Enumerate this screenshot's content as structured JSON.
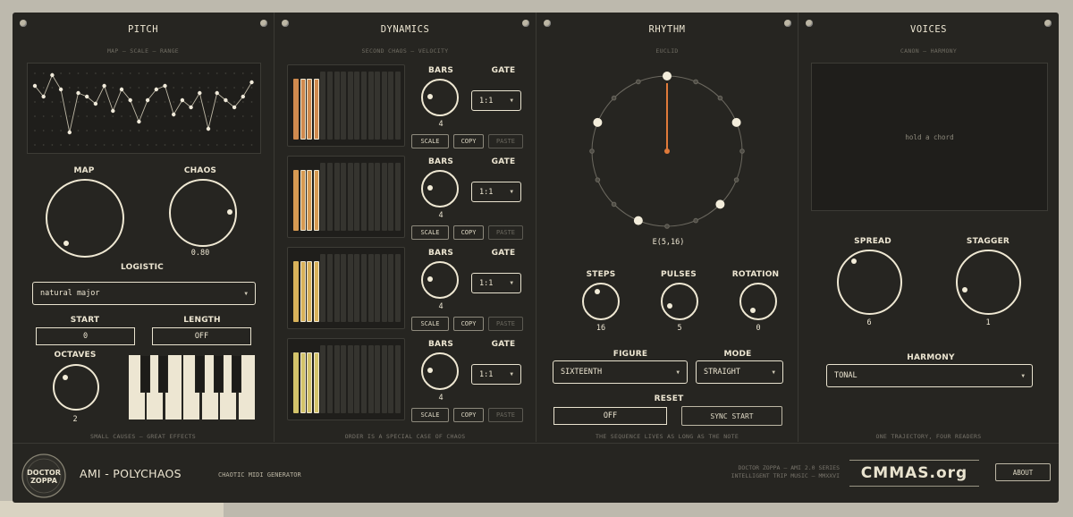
{
  "app": {
    "title": "AMI - POLYCHAOS",
    "subtitle": "CHAOTIC MIDI GENERATOR",
    "logo_text": "DOCTOR ZOPPA",
    "credits_line1": "DOCTOR ZOPPA — AMI 2.0 SERIES",
    "credits_line2": "INTELLIGENT TRIP MUSIC — MMXXVI",
    "partner": "CMMAS.org",
    "about_label": "ABOUT"
  },
  "pitch": {
    "title": "PITCH",
    "subtitle": "MAP — SCALE — RANGE",
    "map_label": "MAP",
    "chaos_label": "CHAOS",
    "chaos_value": "0.80",
    "map_mode": "LOGISTIC",
    "scale": "natural major",
    "start_label": "START",
    "start_value": "0",
    "length_label": "LENGTH",
    "length_value": "OFF",
    "octaves_label": "OCTAVES",
    "octaves_value": "2",
    "footer": "SMALL CAUSES — GREAT EFFECTS",
    "trajectory": [
      0.2,
      0.35,
      0.05,
      0.25,
      0.85,
      0.3,
      0.35,
      0.45,
      0.2,
      0.55,
      0.25,
      0.4,
      0.7,
      0.4,
      0.25,
      0.2,
      0.6,
      0.4,
      0.5,
      0.3,
      0.8,
      0.3,
      0.4,
      0.5,
      0.35,
      0.15
    ]
  },
  "dynamics": {
    "title": "DYNAMICS",
    "subtitle": "SECOND CHAOS — VELOCITY",
    "footer": "ORDER IS A SPECIAL CASE OF CHAOS",
    "rows": [
      {
        "bars_label": "BARS",
        "gate_label": "GATE",
        "bars_value": "4",
        "gate_value": "1:1",
        "scale": "SCALE",
        "copy": "COPY",
        "paste": "PASTE",
        "color": "#d08a4e"
      },
      {
        "bars_label": "BARS",
        "gate_label": "GATE",
        "bars_value": "4",
        "gate_value": "1:1",
        "scale": "SCALE",
        "copy": "COPY",
        "paste": "PASTE",
        "color": "#d79a52"
      },
      {
        "bars_label": "BARS",
        "gate_label": "GATE",
        "bars_value": "4",
        "gate_value": "1:1",
        "scale": "SCALE",
        "copy": "COPY",
        "paste": "PASTE",
        "color": "#d9b25a"
      },
      {
        "bars_label": "BARS",
        "gate_label": "GATE",
        "bars_value": "4",
        "gate_value": "1:1",
        "scale": "SCALE",
        "copy": "COPY",
        "paste": "PASTE",
        "color": "#d3c36a"
      }
    ]
  },
  "rhythm": {
    "title": "RHYTHM",
    "subtitle": "EUCLID",
    "pattern": "E(5,16)",
    "steps_label": "STEPS",
    "steps_value": "16",
    "pulses_label": "PULSES",
    "pulses_value": "5",
    "rotation_label": "ROTATION",
    "rotation_value": "0",
    "figure_label": "FIGURE",
    "figure_value": "SIXTEENTH",
    "mode_label": "MODE",
    "mode_value": "STRAIGHT",
    "reset_label": "RESET",
    "reset_value": "OFF",
    "sync_label": "SYNC START",
    "footer": "THE SEQUENCE LIVES AS LONG AS THE NOTE",
    "accent": "#e07a3a"
  },
  "voices": {
    "title": "VOICES",
    "subtitle": "CANON — HARMONY",
    "chord_hint": "hold a chord",
    "spread_label": "SPREAD",
    "spread_value": "6",
    "stagger_label": "STAGGER",
    "stagger_value": "1",
    "harmony_label": "HARMONY",
    "harmony_value": "TONAL",
    "footer": "ONE TRAJECTORY, FOUR READERS"
  }
}
